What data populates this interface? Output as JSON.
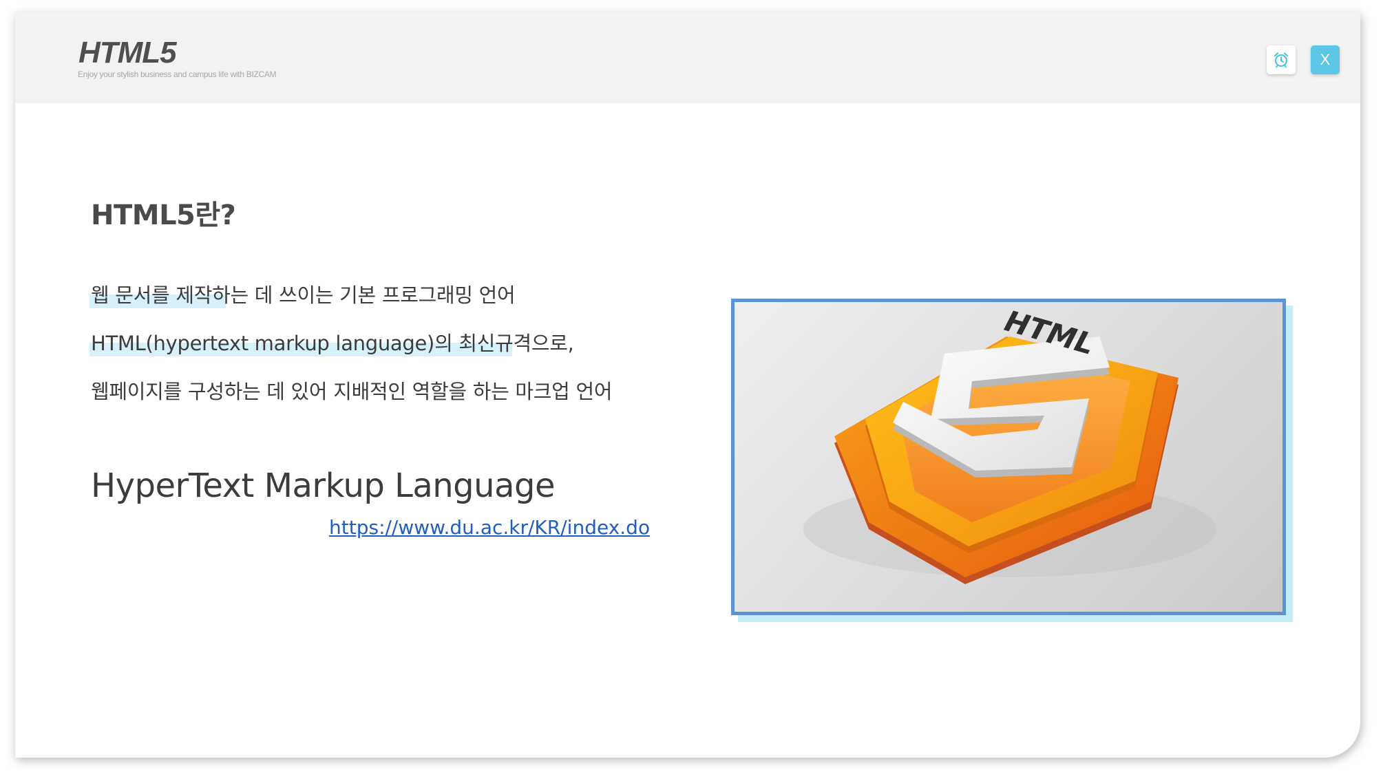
{
  "header": {
    "title": "HTML5",
    "subtitle": "Enjoy your stylish business and campus life with BIZCAM",
    "close_label": "X"
  },
  "content": {
    "heading": "HTML5란?",
    "lines": [
      "웹 문서를 제작하는 데 쓰이는 기본 프로그래밍 언어",
      "HTML(hypertext markup language)의 최신규격으로,",
      "웹페이지를 구성하는 데 있어 지배적인 역할을 하는 마크업 언어"
    ],
    "term": "HyperText Markup Language",
    "link": "https://www.du.ac.kr/KR/index.do"
  },
  "image": {
    "logo_text": "HTML",
    "logo_number": "5"
  },
  "colors": {
    "header_bg": "#f2f2f2",
    "accent": "#5cc6e6",
    "highlight": "#d6f1f9",
    "frame_border": "#5b94d6",
    "link": "#1f5fbf"
  }
}
